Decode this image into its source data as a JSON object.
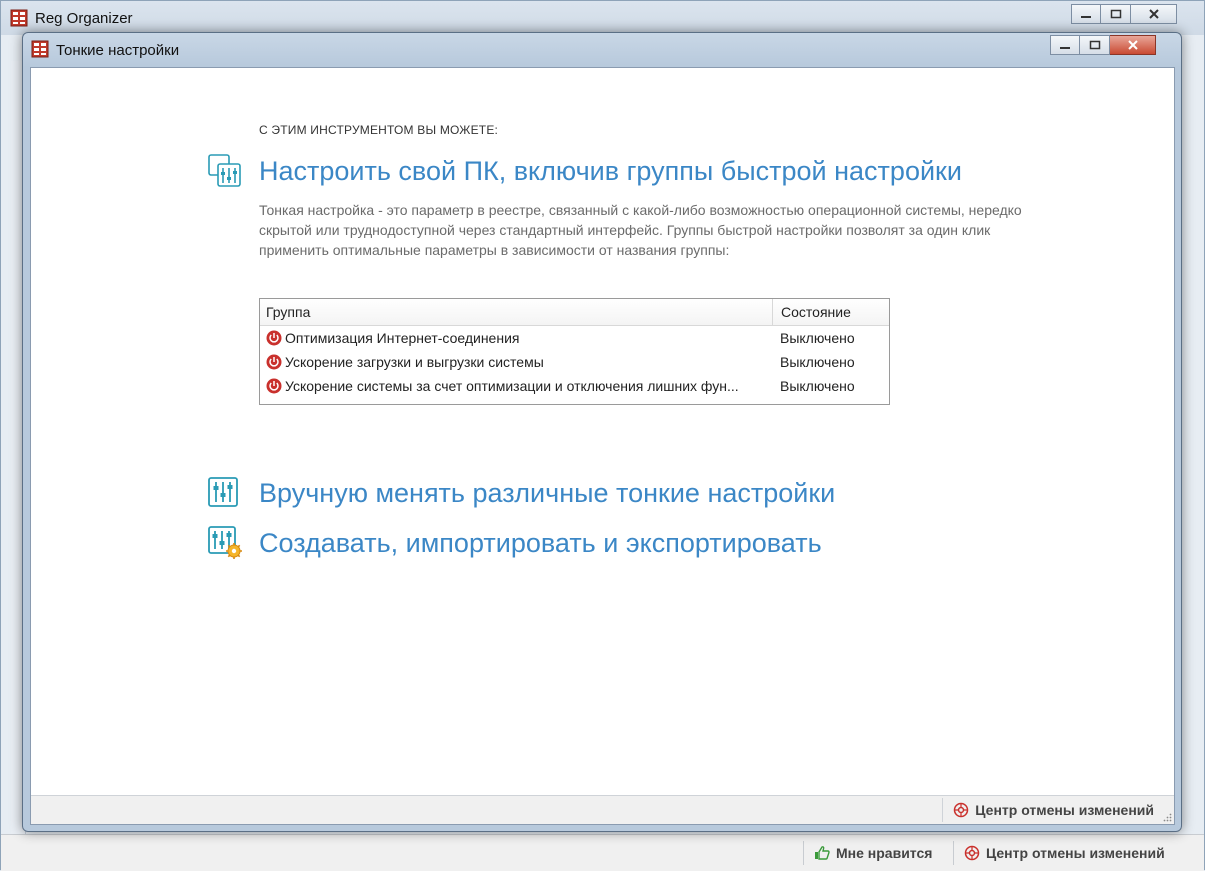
{
  "main_window": {
    "title": "Reg Organizer",
    "status": {
      "like_label": "Мне нравится",
      "undo_center_label": "Центр отмены изменений"
    }
  },
  "dialog": {
    "title": "Тонкие настройки",
    "caption": "С ЭТИМ ИНСТРУМЕНТОМ ВЫ МОЖЕТЕ:",
    "sections": {
      "quick": {
        "heading": "Настроить свой ПК, включив группы быстрой настройки",
        "description": "Тонкая настройка - это параметр в реестре, связанный с какой-либо возможностью операционной системы, нередко скрытой или труднодоступной через стандартный интерфейс. Группы быстрой настройки позволят за один клик применить оптимальные параметры в зависимости от названия группы:"
      },
      "manual": {
        "heading": "Вручную менять различные тонкие настройки"
      },
      "create": {
        "heading": "Создавать, импортировать и экспортировать"
      }
    },
    "groups_table": {
      "headers": {
        "group": "Группа",
        "state": "Состояние"
      },
      "rows": [
        {
          "group": "Оптимизация Интернет-соединения",
          "state": "Выключено"
        },
        {
          "group": "Ускорение загрузки и выгрузки системы",
          "state": "Выключено"
        },
        {
          "group": "Ускорение системы за счет оптимизации и отключения лишних фун...",
          "state": "Выключено"
        }
      ]
    },
    "status": {
      "undo_center_label": "Центр отмены изменений"
    }
  },
  "colors": {
    "accent_blue": "#3b87c6",
    "icon_teal": "#2a9bb5",
    "off_red": "#c9302c"
  },
  "icons": [
    "app-icon",
    "sliders-group-icon",
    "sliders-icon",
    "sliders-gear-icon",
    "power-off-icon",
    "thumbs-up-icon",
    "undo-center-icon"
  ]
}
